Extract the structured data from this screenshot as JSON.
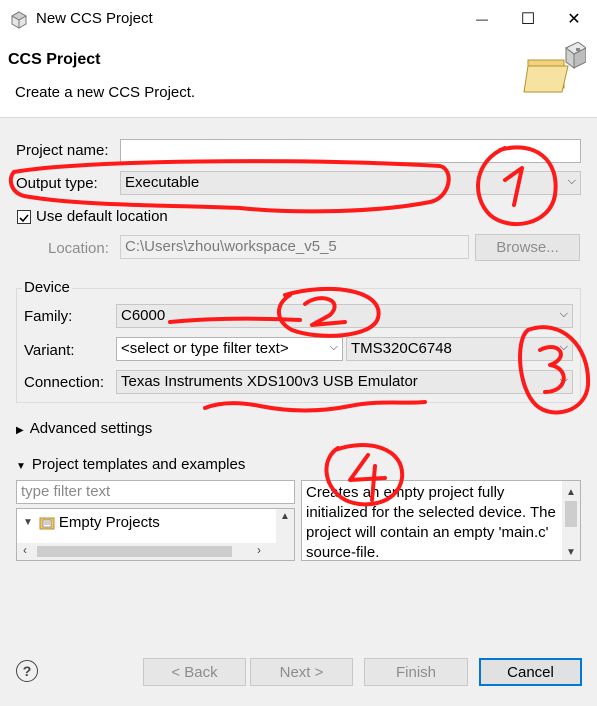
{
  "window": {
    "title": "New CCS Project",
    "minimize_glyph": "—",
    "maximize_glyph": "☐",
    "close_glyph": "✕"
  },
  "header": {
    "title": "CCS Project",
    "description": "Create a new CCS Project."
  },
  "form": {
    "project_name_label": "Project name:",
    "project_name_value": "",
    "output_type_label": "Output type:",
    "output_type_value": "Executable",
    "use_default_location_label": "Use default location",
    "use_default_location_checked": true,
    "location_label": "Location:",
    "location_value": "C:\\Users\\zhou\\workspace_v5_5",
    "browse_label": "Browse..."
  },
  "device": {
    "group_label": "Device",
    "family_label": "Family:",
    "family_value": "C6000",
    "variant_label": "Variant:",
    "variant_filter_placeholder": "<select or type filter text>",
    "variant_value": "TMS320C6748",
    "connection_label": "Connection:",
    "connection_value": "Texas Instruments XDS100v3 USB Emulator"
  },
  "advanced": {
    "label": "Advanced settings",
    "expanded": false
  },
  "templates": {
    "label": "Project templates and examples",
    "expanded": true,
    "filter_placeholder": "type filter text",
    "tree_items": [
      "Empty Projects"
    ],
    "description": "Creates an empty project fully initialized for the selected device. The project will contain an empty 'main.c' source-file."
  },
  "buttons": {
    "back": "< Back",
    "next": "Next >",
    "finish": "Finish",
    "cancel": "Cancel",
    "help_glyph": "?"
  },
  "annotations": {
    "color": "#ff0000",
    "marks": [
      "1",
      "2",
      "3",
      "4"
    ]
  }
}
